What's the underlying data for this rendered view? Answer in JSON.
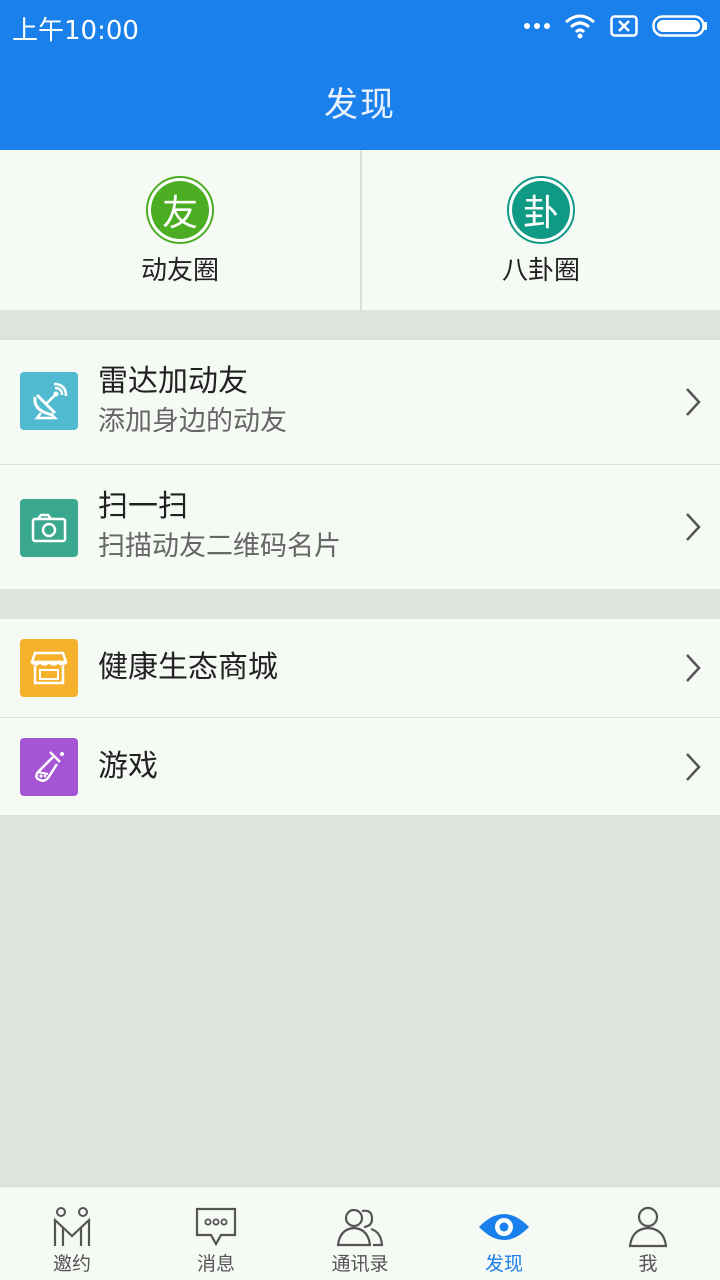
{
  "status_bar": {
    "time": "上午10:00"
  },
  "header": {
    "title": "发现"
  },
  "circles": [
    {
      "glyph": "友",
      "label": "动友圈",
      "color": "#4bae22"
    },
    {
      "glyph": "卦",
      "label": "八卦圈",
      "color": "#0f9a86"
    }
  ],
  "menu": {
    "radar": {
      "title": "雷达加动友",
      "subtitle": "添加身边的动友",
      "icon": "radar-dish-icon",
      "color": "#52bad0"
    },
    "scan": {
      "title": "扫一扫",
      "subtitle": "扫描动友二维码名片",
      "icon": "camera-icon",
      "color": "#3aa88e"
    },
    "mall": {
      "title": "健康生态商城",
      "icon": "store-icon",
      "color": "#f5b12b"
    },
    "games": {
      "title": "游戏",
      "icon": "potion-flask-icon",
      "color": "#a554d3"
    }
  },
  "tabs": [
    {
      "label": "邀约",
      "icon": "invite-icon"
    },
    {
      "label": "消息",
      "icon": "message-icon"
    },
    {
      "label": "通讯录",
      "icon": "contacts-icon"
    },
    {
      "label": "发现",
      "icon": "eye-icon",
      "active": true
    },
    {
      "label": "我",
      "icon": "profile-icon"
    }
  ],
  "colors": {
    "primary": "#1a80eb",
    "background": "#dfe3de",
    "surface": "#f6faf5"
  }
}
